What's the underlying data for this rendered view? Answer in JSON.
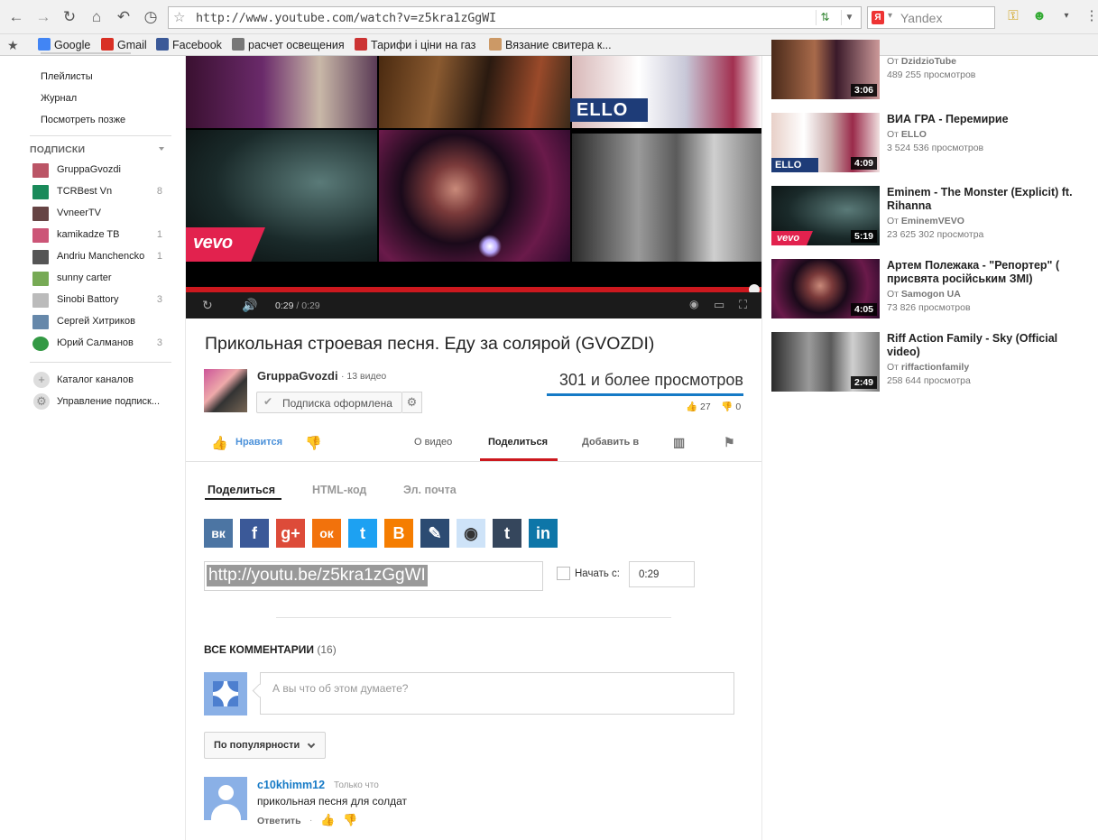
{
  "browser": {
    "url": "http://www.youtube.com/watch?v=z5kra1zGgWI",
    "search_placeholder": "Yandex",
    "search_engine_badge": "Я",
    "bookmarks": [
      {
        "label": "Google",
        "color": "#4285f4"
      },
      {
        "label": "Gmail",
        "color": "#d93025"
      },
      {
        "label": "Facebook",
        "color": "#3b5998"
      },
      {
        "label": "расчет освещения",
        "color": "#777"
      },
      {
        "label": "Тарифи і ціни на газ",
        "color": "#c33"
      },
      {
        "label": "Вязание свитера к...",
        "color": "#c96"
      }
    ]
  },
  "guide": {
    "top_items": [
      "Плейлисты",
      "Журнал",
      "Посмотреть позже"
    ],
    "subscriptions_header": "ПОДПИСКИ",
    "subscriptions": [
      {
        "name": "GruppaGvozdi",
        "count": "",
        "color": "#b56"
      },
      {
        "name": "TCRBest Vn",
        "count": "8",
        "color": "#1a8a5a"
      },
      {
        "name": "VvneerTV",
        "count": "",
        "color": "#644"
      },
      {
        "name": "kamikadze TB",
        "count": "1",
        "color": "#c57"
      },
      {
        "name": "Andriu Manchencko",
        "count": "1",
        "color": "#555"
      },
      {
        "name": "sunny carter",
        "count": "",
        "color": "#7a5"
      },
      {
        "name": "Sinobi Battory",
        "count": "3",
        "color": "#bbb"
      },
      {
        "name": "Сергей Хитриков",
        "count": "",
        "color": "#68a"
      },
      {
        "name": "Юрий Салманов",
        "count": "3",
        "color": "#394"
      }
    ],
    "tools": [
      {
        "name": "Каталог каналов",
        "icon": "plus-circle-icon"
      },
      {
        "name": "Управление подписк...",
        "icon": "gear-icon"
      }
    ]
  },
  "player": {
    "current_time": "0:29",
    "duration": "/ 0:29",
    "progress_fraction": 1.0,
    "vevo_label": "vevo",
    "ello_label": "ELLO"
  },
  "video": {
    "title": "Прикольная строевая песня. Еду за солярой (GVOZDI)",
    "channel": "GruppaGvozdi",
    "video_count": "· 13 видео",
    "subscribe_label": "Подписка оформлена",
    "views": "301 и более просмотров",
    "likes": "27",
    "dislikes": "0",
    "like_label": "Нравится"
  },
  "action_tabs": [
    {
      "label": "О видео"
    },
    {
      "label": "Поделиться"
    },
    {
      "label": "Добавить в"
    }
  ],
  "share": {
    "tabs": [
      "Поделиться",
      "HTML-код",
      "Эл. почта"
    ],
    "social": [
      {
        "name": "vk",
        "glyph": "вк",
        "color": "#4c75a3"
      },
      {
        "name": "facebook",
        "glyph": "f",
        "color": "#3b5998"
      },
      {
        "name": "google-plus",
        "glyph": "g+",
        "color": "#dd4b39"
      },
      {
        "name": "odnoklassniki",
        "glyph": "ок",
        "color": "#f2720c"
      },
      {
        "name": "twitter",
        "glyph": "t",
        "color": "#1da1f2"
      },
      {
        "name": "blogger",
        "glyph": "B",
        "color": "#f57d00"
      },
      {
        "name": "livejournal",
        "glyph": "✎",
        "color": "#2c4b72"
      },
      {
        "name": "reddit",
        "glyph": "◉",
        "color": "#cee3f8"
      },
      {
        "name": "tumblr",
        "glyph": "t",
        "color": "#35465c"
      },
      {
        "name": "linkedin",
        "glyph": "in",
        "color": "#0e76a8"
      }
    ],
    "short_url": "http://youtu.be/z5kra1zGgWI",
    "start_at_label": "Начать с:",
    "start_at_value": "0:29"
  },
  "comments": {
    "header": "ВСЕ КОММЕНТАРИИ",
    "count": "(16)",
    "placeholder": "А вы что об этом думаете?",
    "sort_label": "По популярности",
    "items": [
      {
        "user": "c10khimm12",
        "time": "Только что",
        "text": "прикольная песня для солдат",
        "reply": "Ответить"
      }
    ]
  },
  "related": [
    {
      "title": "",
      "author_prefix": "От",
      "author": "DzidzioTube",
      "views": "489 255 просмотров",
      "duration": "3:06"
    },
    {
      "title": "ВИА ГРА - Перемирие",
      "author_prefix": "От",
      "author": "ELLO",
      "views": "3 524 536 просмотров",
      "duration": "4:09"
    },
    {
      "title": "Eminem - The Monster (Explicit) ft. Rihanna",
      "author_prefix": "От",
      "author": "EminemVEVO",
      "views": "23 625 302 просмотра",
      "duration": "5:19"
    },
    {
      "title": "Артем Полежака - \"Репортер\" ( присвята російським ЗМІ)",
      "author_prefix": "От",
      "author": "Samogon UA",
      "views": "73 826 просмотров",
      "duration": "4:05"
    },
    {
      "title": "Riff Action Family - Sky (Official video)",
      "author_prefix": "От",
      "author": "riffactionfamily",
      "views": "258 644 просмотра",
      "duration": "2:49"
    }
  ]
}
